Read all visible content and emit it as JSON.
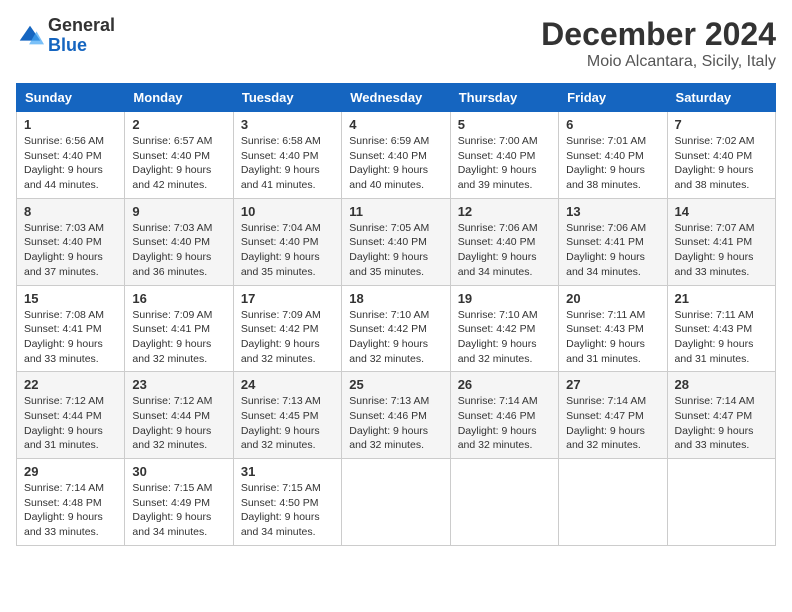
{
  "logo": {
    "line1": "General",
    "line2": "Blue"
  },
  "title": "December 2024",
  "subtitle": "Moio Alcantara, Sicily, Italy",
  "weekdays": [
    "Sunday",
    "Monday",
    "Tuesday",
    "Wednesday",
    "Thursday",
    "Friday",
    "Saturday"
  ],
  "weeks": [
    [
      {
        "day": "1",
        "sunrise": "6:56 AM",
        "sunset": "4:40 PM",
        "daylight": "9 hours and 44 minutes."
      },
      {
        "day": "2",
        "sunrise": "6:57 AM",
        "sunset": "4:40 PM",
        "daylight": "9 hours and 42 minutes."
      },
      {
        "day": "3",
        "sunrise": "6:58 AM",
        "sunset": "4:40 PM",
        "daylight": "9 hours and 41 minutes."
      },
      {
        "day": "4",
        "sunrise": "6:59 AM",
        "sunset": "4:40 PM",
        "daylight": "9 hours and 40 minutes."
      },
      {
        "day": "5",
        "sunrise": "7:00 AM",
        "sunset": "4:40 PM",
        "daylight": "9 hours and 39 minutes."
      },
      {
        "day": "6",
        "sunrise": "7:01 AM",
        "sunset": "4:40 PM",
        "daylight": "9 hours and 38 minutes."
      },
      {
        "day": "7",
        "sunrise": "7:02 AM",
        "sunset": "4:40 PM",
        "daylight": "9 hours and 38 minutes."
      }
    ],
    [
      {
        "day": "8",
        "sunrise": "7:03 AM",
        "sunset": "4:40 PM",
        "daylight": "9 hours and 37 minutes."
      },
      {
        "day": "9",
        "sunrise": "7:03 AM",
        "sunset": "4:40 PM",
        "daylight": "9 hours and 36 minutes."
      },
      {
        "day": "10",
        "sunrise": "7:04 AM",
        "sunset": "4:40 PM",
        "daylight": "9 hours and 35 minutes."
      },
      {
        "day": "11",
        "sunrise": "7:05 AM",
        "sunset": "4:40 PM",
        "daylight": "9 hours and 35 minutes."
      },
      {
        "day": "12",
        "sunrise": "7:06 AM",
        "sunset": "4:40 PM",
        "daylight": "9 hours and 34 minutes."
      },
      {
        "day": "13",
        "sunrise": "7:06 AM",
        "sunset": "4:41 PM",
        "daylight": "9 hours and 34 minutes."
      },
      {
        "day": "14",
        "sunrise": "7:07 AM",
        "sunset": "4:41 PM",
        "daylight": "9 hours and 33 minutes."
      }
    ],
    [
      {
        "day": "15",
        "sunrise": "7:08 AM",
        "sunset": "4:41 PM",
        "daylight": "9 hours and 33 minutes."
      },
      {
        "day": "16",
        "sunrise": "7:09 AM",
        "sunset": "4:41 PM",
        "daylight": "9 hours and 32 minutes."
      },
      {
        "day": "17",
        "sunrise": "7:09 AM",
        "sunset": "4:42 PM",
        "daylight": "9 hours and 32 minutes."
      },
      {
        "day": "18",
        "sunrise": "7:10 AM",
        "sunset": "4:42 PM",
        "daylight": "9 hours and 32 minutes."
      },
      {
        "day": "19",
        "sunrise": "7:10 AM",
        "sunset": "4:42 PM",
        "daylight": "9 hours and 32 minutes."
      },
      {
        "day": "20",
        "sunrise": "7:11 AM",
        "sunset": "4:43 PM",
        "daylight": "9 hours and 31 minutes."
      },
      {
        "day": "21",
        "sunrise": "7:11 AM",
        "sunset": "4:43 PM",
        "daylight": "9 hours and 31 minutes."
      }
    ],
    [
      {
        "day": "22",
        "sunrise": "7:12 AM",
        "sunset": "4:44 PM",
        "daylight": "9 hours and 31 minutes."
      },
      {
        "day": "23",
        "sunrise": "7:12 AM",
        "sunset": "4:44 PM",
        "daylight": "9 hours and 32 minutes."
      },
      {
        "day": "24",
        "sunrise": "7:13 AM",
        "sunset": "4:45 PM",
        "daylight": "9 hours and 32 minutes."
      },
      {
        "day": "25",
        "sunrise": "7:13 AM",
        "sunset": "4:46 PM",
        "daylight": "9 hours and 32 minutes."
      },
      {
        "day": "26",
        "sunrise": "7:14 AM",
        "sunset": "4:46 PM",
        "daylight": "9 hours and 32 minutes."
      },
      {
        "day": "27",
        "sunrise": "7:14 AM",
        "sunset": "4:47 PM",
        "daylight": "9 hours and 32 minutes."
      },
      {
        "day": "28",
        "sunrise": "7:14 AM",
        "sunset": "4:47 PM",
        "daylight": "9 hours and 33 minutes."
      }
    ],
    [
      {
        "day": "29",
        "sunrise": "7:14 AM",
        "sunset": "4:48 PM",
        "daylight": "9 hours and 33 minutes."
      },
      {
        "day": "30",
        "sunrise": "7:15 AM",
        "sunset": "4:49 PM",
        "daylight": "9 hours and 34 minutes."
      },
      {
        "day": "31",
        "sunrise": "7:15 AM",
        "sunset": "4:50 PM",
        "daylight": "9 hours and 34 minutes."
      },
      null,
      null,
      null,
      null
    ]
  ]
}
